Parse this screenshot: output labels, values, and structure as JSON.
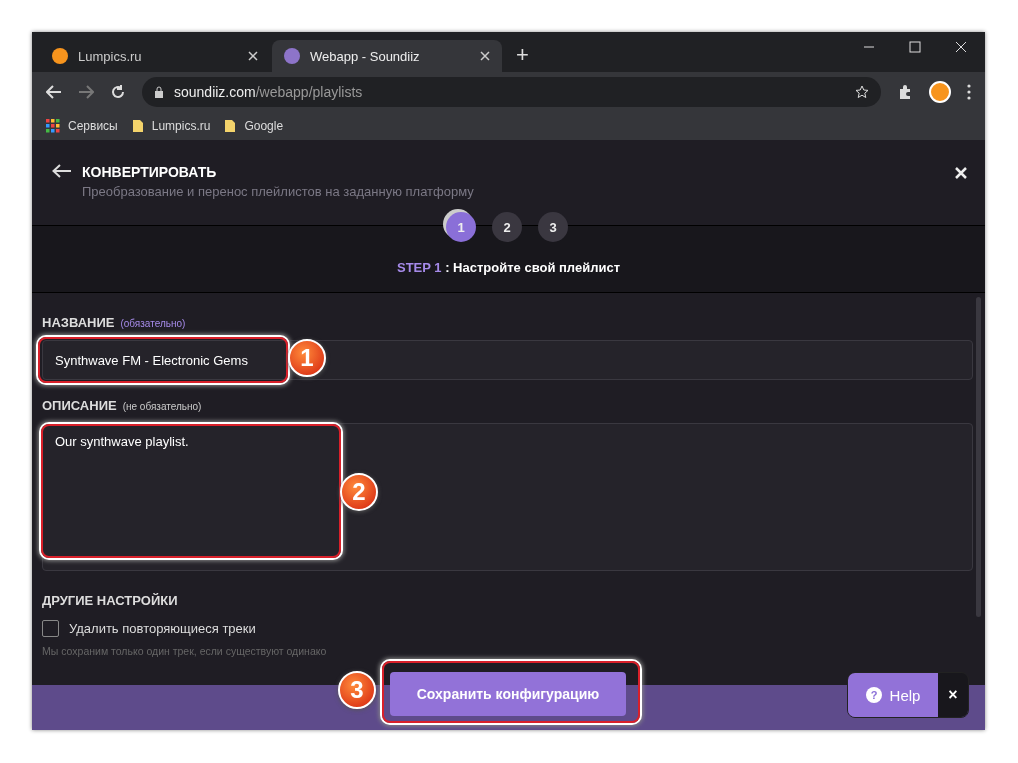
{
  "browser": {
    "tabs": [
      {
        "title": "Lumpics.ru",
        "selected": false
      },
      {
        "title": "Webapp - Soundiiz",
        "selected": true
      }
    ],
    "new_tab": "+",
    "url_host": "soundiiz.com",
    "url_path": "/webapp/playlists",
    "bookmarks": [
      "Сервисы",
      "Lumpics.ru",
      "Google"
    ]
  },
  "header": {
    "title": "КОНВЕРТИРОВАТЬ",
    "subtitle": "Преобразование и перенос плейлистов на заданную платформу"
  },
  "steps": [
    {
      "label": "1",
      "selected": true
    },
    {
      "label": "2",
      "selected": false
    },
    {
      "label": "3",
      "selected": false
    }
  ],
  "step_caption": {
    "step": "STEP 1",
    "sep": " : ",
    "text": "Настройте свой плейлист"
  },
  "name_field": {
    "label": "НАЗВАНИЕ",
    "hint": "(обязательно)",
    "value": "Synthwave FM - Electronic Gems"
  },
  "description_field": {
    "label": "ОПИСАНИЕ",
    "hint": "(не обязательно)",
    "value": "Our synthwave playlist."
  },
  "other_settings": {
    "title": "ДРУГИЕ НАСТРОЙКИ",
    "checkbox": {
      "label": "Удалить повторяющиеся треки",
      "checked": false
    },
    "note": "Мы сохраним только один трек, если существуют одинако"
  },
  "save_button": "Сохранить конфигурацию",
  "help_button": "Help",
  "help_icon": "?",
  "help_close": "×",
  "annotations": [
    "1",
    "2",
    "3"
  ]
}
